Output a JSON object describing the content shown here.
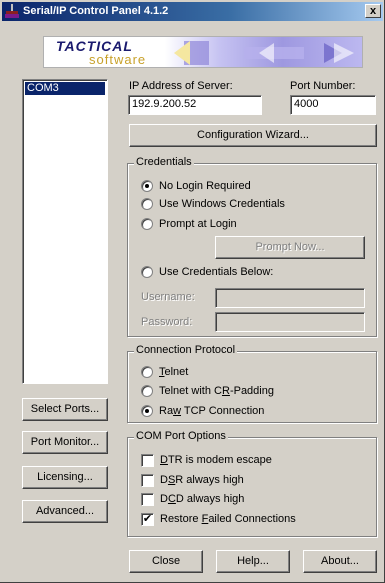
{
  "window": {
    "title": "Serial/IP Control Panel 4.1.2",
    "close_glyph": "x"
  },
  "banner": {
    "brand_top": "TACTICAL",
    "brand_bottom": "software"
  },
  "ports": {
    "items": [
      "COM3"
    ]
  },
  "server": {
    "ip_label": "IP Address of Server:",
    "ip_value": "192.9.200.52",
    "port_label": "Port Number:",
    "port_value": "4000"
  },
  "buttons": {
    "config_wizard": "Configuration Wizard...",
    "select_ports": "Select Ports...",
    "port_monitor": "Port Monitor...",
    "licensing": "Licensing...",
    "advanced": "Advanced...",
    "close": "Close",
    "help": "Help...",
    "about": "About..."
  },
  "credentials": {
    "group_label": "Credentials",
    "no_login": "No Login Required",
    "windows_creds": "Use Windows Credentials",
    "prompt_login": "Prompt at Login",
    "prompt_now": "Prompt Now...",
    "use_below": "Use Credentials Below:",
    "username_label": "Username:",
    "password_label": "Password:",
    "username_value": "",
    "password_value": "",
    "selected": "no_login"
  },
  "protocol": {
    "group_label": "Connection Protocol",
    "telnet_prefix": "",
    "telnet_acc": "T",
    "telnet_rest": "elnet",
    "telnet_cr_prefix": "Telnet with C",
    "telnet_cr_acc": "R",
    "telnet_cr_rest": "-Padding",
    "raw_prefix": "Ra",
    "raw_acc": "w",
    "raw_rest": " TCP Connection",
    "selected": "raw"
  },
  "com_options": {
    "group_label": "COM Port Options",
    "dtr_acc": "D",
    "dtr_rest": "TR is modem escape",
    "dsr_prefix": "D",
    "dsr_acc": "S",
    "dsr_rest": "R always high",
    "dcd_prefix": "D",
    "dcd_acc": "C",
    "dcd_rest": "D always high",
    "restore_prefix": "Restore ",
    "restore_acc": "F",
    "restore_rest": "ailed Connections",
    "checked": {
      "dtr": false,
      "dsr": false,
      "dcd": false,
      "restore": true
    },
    "check_glyph": "✔"
  },
  "colors": {
    "face": "#d4d0c8",
    "titlebar_start": "#0a246a",
    "titlebar_end": "#a6caf0",
    "selection": "#0a246a"
  }
}
